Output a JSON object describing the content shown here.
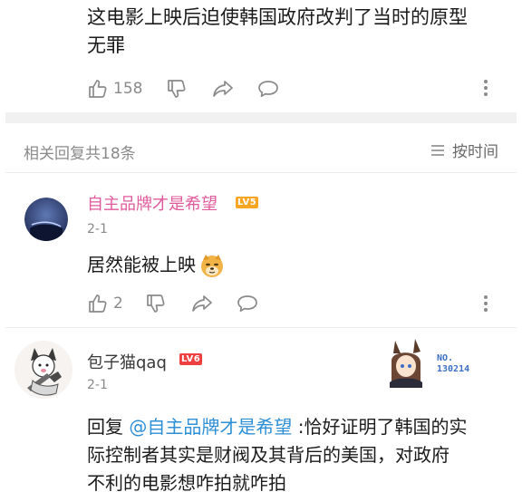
{
  "main_comment": {
    "text_line1": "这电影上映后迫使韩国政府改判了当时的原型",
    "text_line2": "无罪",
    "likes": "158"
  },
  "replies_header": {
    "count_label": "相关回复共18条",
    "sort_label": "按时间"
  },
  "replies": [
    {
      "username": "自主品牌才是希望",
      "level": "LV5",
      "time": "2-1",
      "text": "居然能被上映",
      "emoji": "doge-emoji",
      "likes": "2",
      "username_color": "#e05a9b"
    },
    {
      "username": "包子猫qaq",
      "level": "LV6",
      "time": "2-1",
      "reply_prefix": "回复 ",
      "mention": "@自主品牌才是希望",
      "text_after_mention": " :恰好证明了韩国的实",
      "text_line2": "际控制者其实是财阀及其背后的美国，对政府",
      "text_line3": "不利的电影想咋拍就咋拍",
      "pendant_label": "NO.\n130214",
      "mention_color": "#2e8fd6"
    }
  ],
  "icons": [
    "thumb-up-icon",
    "thumb-down-icon",
    "share-icon",
    "comment-icon",
    "more-icon",
    "sort-icon"
  ],
  "colors": {
    "lv5": "#f6a623",
    "lv6": "#ee4040",
    "muted": "#8a8a8a"
  }
}
